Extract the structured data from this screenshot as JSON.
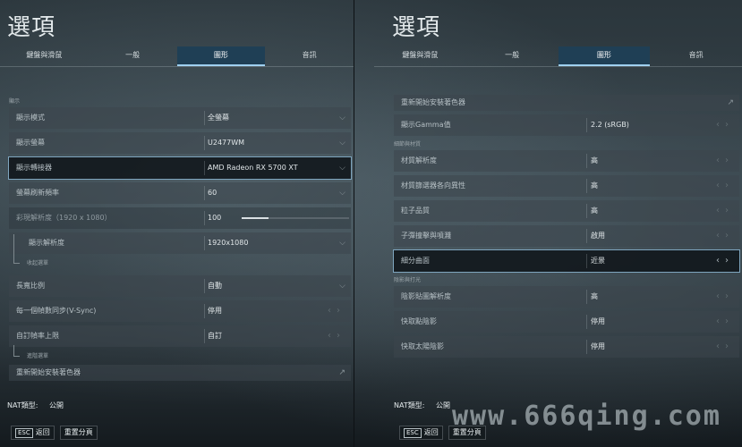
{
  "left": {
    "title": "選項",
    "tabs": [
      "鍵盤與滑鼠",
      "一般",
      "圖形",
      "音訊"
    ],
    "section_display": "顯示",
    "rows": [
      {
        "label": "顯示模式",
        "value": "全螢幕"
      },
      {
        "label": "顯示螢幕",
        "value": "U2477WM"
      },
      {
        "label": "顯示轉接器",
        "value": "AMD Radeon RX 5700 XT"
      },
      {
        "label": "螢幕刷新頻率",
        "value": "60"
      },
      {
        "label": "彩現解析度（1920 x 1080）",
        "value": "100",
        "slider": 0.25
      },
      {
        "label": "顯示解析度",
        "value": "1920x1080"
      },
      {
        "label": "長寬比例",
        "value": "自動"
      },
      {
        "label": "每一個幀數同步(V-Sync)",
        "value": "停用"
      },
      {
        "label": "自訂幀率上限",
        "value": "自訂"
      },
      {
        "label": "重新開始安裝著色器"
      }
    ],
    "collapse_menu": "收起選單",
    "advanced_menu": "進階選單",
    "nat": {
      "label": "NAT類型:",
      "value": "公開"
    },
    "footer": {
      "back_key": "ESC",
      "back_label": "返回",
      "reset_label": "重置分頁"
    }
  },
  "right": {
    "title": "選項",
    "tabs": [
      "鍵盤與滑鼠",
      "一般",
      "圖形",
      "音訊"
    ],
    "rows_top": [
      {
        "label": "重新開始安裝著色器"
      },
      {
        "label": "顯示Gamma值",
        "value": "2.2 (sRGB)"
      }
    ],
    "section_texture": "細節與材質",
    "rows_texture": [
      {
        "label": "材質解析度",
        "value": "高"
      },
      {
        "label": "材質篩選器各向異性",
        "value": "高"
      },
      {
        "label": "粒子品質",
        "value": "高"
      },
      {
        "label": "子彈撞擊與噴濺",
        "value": "啟用"
      },
      {
        "label": "細分曲面",
        "value": "近景"
      }
    ],
    "section_shadow": "陰影與打光",
    "rows_shadow": [
      {
        "label": "陰影貼圖解析度",
        "value": "高"
      },
      {
        "label": "快取點陰影",
        "value": "停用"
      },
      {
        "label": "快取太陽陰影",
        "value": "停用"
      }
    ],
    "nat": {
      "label": "NAT類型:",
      "value": "公開"
    },
    "footer": {
      "back_key": "ESC",
      "back_label": "返回",
      "reset_label": "重置分頁"
    }
  },
  "watermark": "www.666qing.com",
  "colors": {
    "accent": "#9fd0f0",
    "tab_active_bg": "#1f3f55"
  }
}
